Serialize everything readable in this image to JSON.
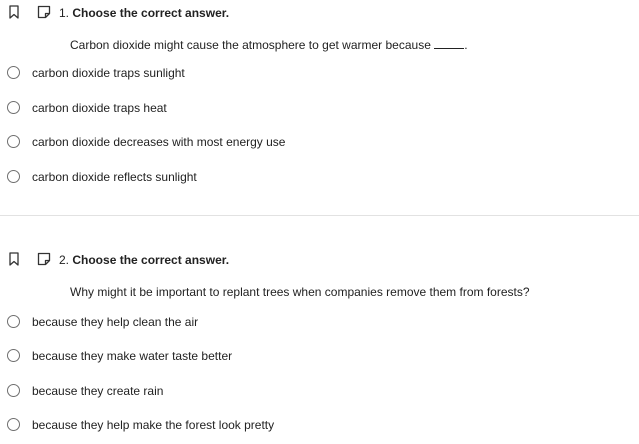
{
  "questions": [
    {
      "number": "1.",
      "instruction": "Choose the correct answer.",
      "prompt": "Carbon dioxide might cause the atmosphere to get warmer because",
      "prompt_end": ".",
      "options": [
        "carbon dioxide traps sunlight",
        "carbon dioxide traps heat",
        "carbon dioxide decreases with most energy use",
        "carbon dioxide reflects sunlight"
      ]
    },
    {
      "number": "2.",
      "instruction": "Choose the correct answer.",
      "prompt": "Why might it be important to replant trees when companies remove them from forests?",
      "options": [
        "because they help clean the air",
        "because they make water taste better",
        "because they create rain",
        "because they help make the forest look pretty"
      ]
    }
  ],
  "icons": {
    "bookmark": "bookmark-icon",
    "note": "note-icon",
    "radio": "radio-button"
  },
  "colors": {
    "text": "#222222",
    "radio_border": "#6f6f6f",
    "divider": "#e2e2e2"
  }
}
